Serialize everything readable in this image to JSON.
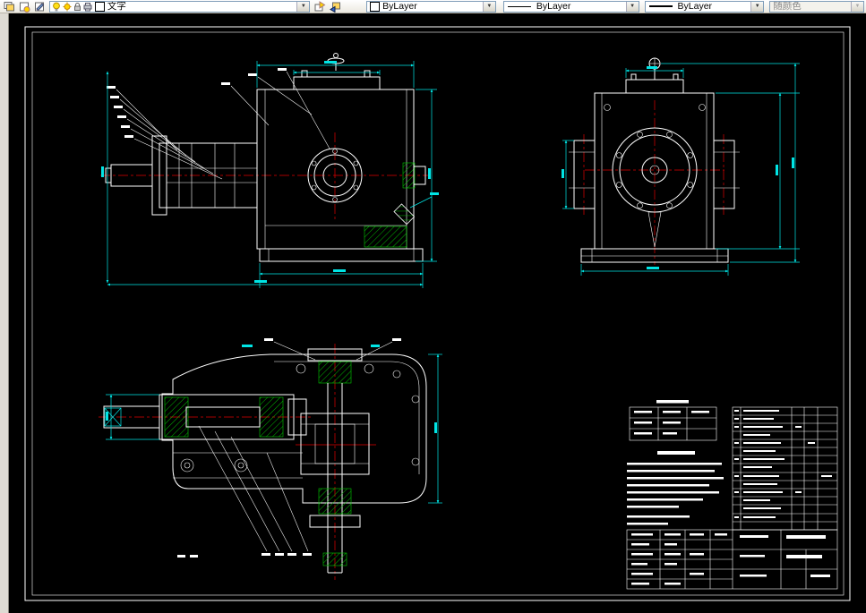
{
  "toolbar": {
    "layers": {
      "properties_button_icon": "layer-properties-manager",
      "states_button_icon": "layer-states",
      "tools_button_icon": "layer-translate",
      "layer_name": "文字",
      "status_icons": [
        "bulb-on",
        "sun",
        "lock-open",
        "printer",
        "color-chip-white"
      ],
      "make_current_button_icon": "make-object-layer-current",
      "previous_button_icon": "layer-previous"
    },
    "properties": {
      "color_value": "ByLayer",
      "linetype_value": "ByLayer",
      "lineweight_value": "ByLayer",
      "plot_style_value": "随颜色",
      "plot_style_enabled": false
    }
  },
  "canvas": {
    "colors": {
      "background": "#000000",
      "sheet_frame": "#ffffff",
      "object_lines": "#ffffff",
      "dimension_lines": "#00e5e5",
      "center_lines": "#e00000",
      "section_hatch": "#00cc00"
    },
    "content": {
      "drawing_type": "worm-gearbox-assembly-drawing",
      "views": [
        "front-section-view",
        "side-view",
        "plan-section-view"
      ],
      "title_block": "title-block-with-parts-list"
    }
  }
}
